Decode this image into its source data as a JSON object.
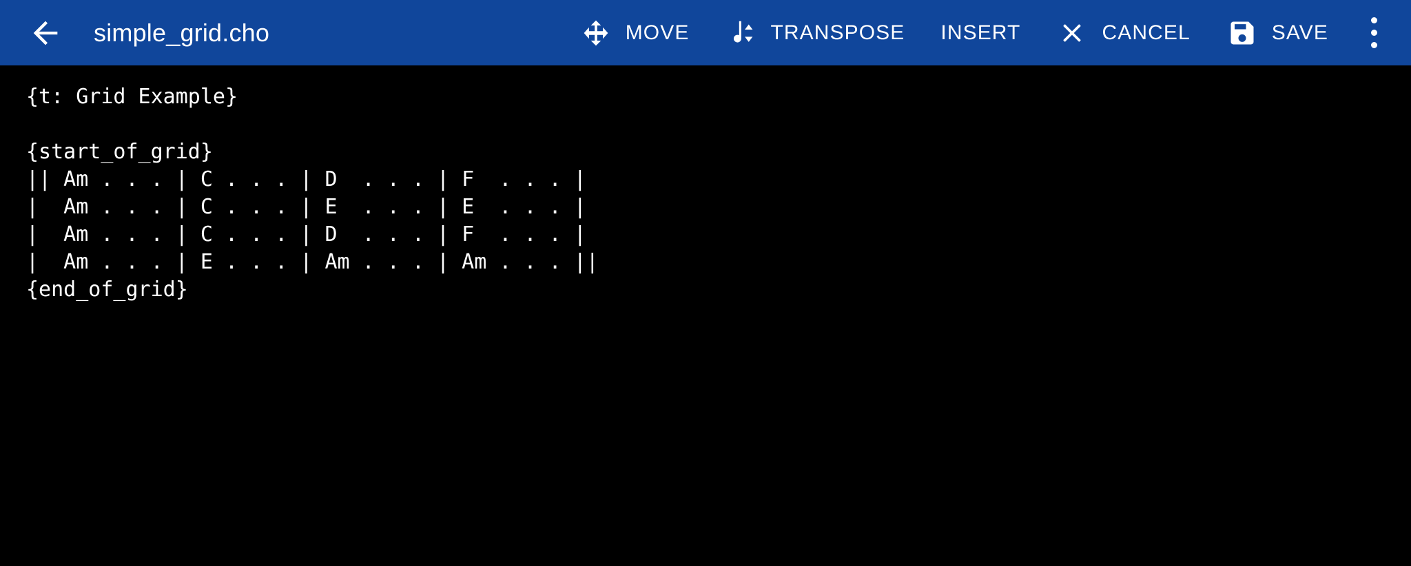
{
  "app_bar": {
    "background_color": "#10469B",
    "back_icon": "arrow-back-icon",
    "title": "simple_grid.cho",
    "actions": [
      {
        "id": "move",
        "label": "MOVE",
        "icon": "move-cross-arrows-icon"
      },
      {
        "id": "transpose",
        "label": "TRANSPOSE",
        "icon": "transpose-note-arrows-icon"
      },
      {
        "id": "insert",
        "label": "INSERT",
        "icon": null
      },
      {
        "id": "cancel",
        "label": "CANCEL",
        "icon": "close-x-icon"
      },
      {
        "id": "save",
        "label": "SAVE",
        "icon": "floppy-disk-save-icon"
      }
    ],
    "overflow_icon": "more-vert-icon"
  },
  "editor": {
    "background_color": "#000000",
    "text_color": "#FFFFFF",
    "content": "{t: Grid Example}\n\n{start_of_grid}\n|| Am . . . | C . . . | D  . . . | F  . . . |\n|  Am . . . | C . . . | E  . . . | E  . . . |\n|  Am . . . | C . . . | D  . . . | F  . . . |\n|  Am . . . | E . . . | Am . . . | Am . . . ||\n{end_of_grid}",
    "lines": [
      "{t: Grid Example}",
      "",
      "{start_of_grid}",
      "|| Am . . . | C . . . | D  . . . | F  . . . |",
      "|  Am . . . | C . . . | E  . . . | E  . . . |",
      "|  Am . . . | C . . . | D  . . . | F  . . . |",
      "|  Am . . . | E . . . | Am . . . | Am . . . ||",
      "{end_of_grid}"
    ]
  }
}
